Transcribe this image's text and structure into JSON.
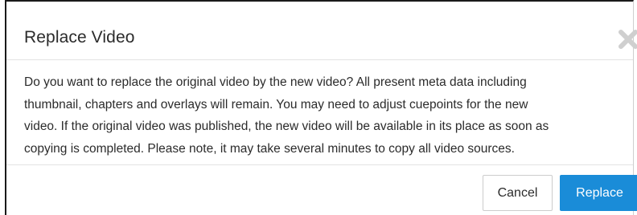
{
  "dialog": {
    "title": "Replace Video",
    "close_icon": "close-icon",
    "message_lines": [
      "Do you want to replace the original video by the new video? All present meta data including",
      "thumbnail, chapters and overlays will remain. You may need to adjust cuepoints for the new",
      "video. If the original video was published, the new video will be available in its place as soon as",
      "copying is completed. Please note, it may take several minutes to copy all video sources."
    ],
    "cancel_label": "Cancel",
    "replace_label": "Replace"
  },
  "colors": {
    "primary": "#1a8cd8",
    "text": "#2b2b2b",
    "close_icon": "#cfcfcf"
  }
}
